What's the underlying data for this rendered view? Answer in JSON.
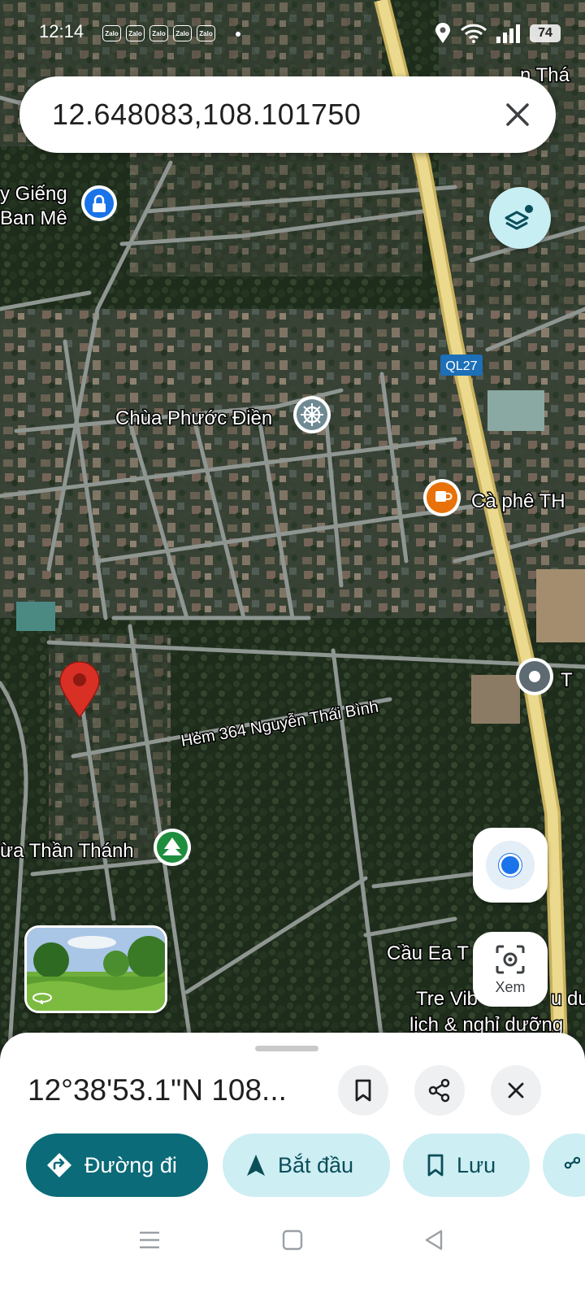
{
  "status_bar": {
    "time": "12:14",
    "zalo_labels": [
      "Zalo",
      "Zalo",
      "Zalo",
      "Zalo",
      "Zalo"
    ],
    "battery": "74"
  },
  "search": {
    "query": "12.648083,108.101750"
  },
  "map_labels": {
    "poi_top_left_line1": "y Giếng",
    "poi_top_left_line2": "Ban Mê",
    "road_badge": "QL27",
    "temple": "Chùa Phước Điền",
    "cafe": "Cà phê TH",
    "road_right": "T",
    "street": "Hẻm 364 Nguyễn Thái Bình",
    "park": "ừa Thần Thánh",
    "bridge": "Cầu Ea T",
    "resort_line1": "Tre Vib",
    "resort_line1_end": "u du",
    "resort_line2": "lịch & nghỉ dưỡng",
    "top_right": "n Thá"
  },
  "view_button": {
    "label": "Xem"
  },
  "place": {
    "title": "12°38'53.1\"N 108..."
  },
  "actions": {
    "directions": "Đường đi",
    "start": "Bắt đầu",
    "save": "Lưu"
  },
  "colors": {
    "primary": "#0b6b78",
    "secondary": "#cdeef3",
    "pin": "#d93025",
    "highway": "#e9d27d"
  }
}
